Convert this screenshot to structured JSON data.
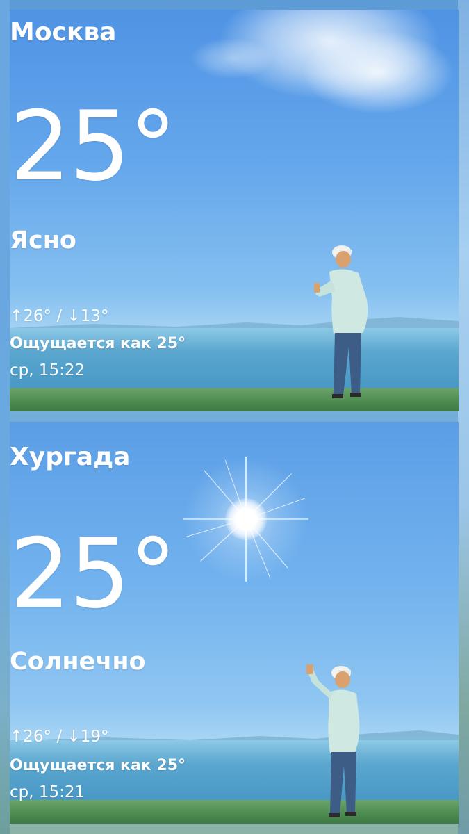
{
  "cards": [
    {
      "city": "Москва",
      "temperature": "25°",
      "condition": "Ясно",
      "high_arrow": "↑",
      "high": "26°",
      "separator": " / ",
      "low_arrow": "↓",
      "low": "13°",
      "feels_like": "Ощущается как 25°",
      "updated": "ср, 15:22"
    },
    {
      "city": "Хургада",
      "temperature": "25°",
      "condition": "Солнечно",
      "high_arrow": "↑",
      "high": "26°",
      "separator": " / ",
      "low_arrow": "↓",
      "low": "19°",
      "feels_like": "Ощущается как 25°",
      "updated": "ср, 15:21"
    }
  ],
  "icons": {
    "background_1": "clear-sky-scene",
    "background_2": "sunny-scene-with-sun"
  },
  "colors": {
    "text": "#ffffff",
    "sky_top": "#4f93e4",
    "sea": "#4495c2",
    "grass": "#4c8b4f"
  }
}
